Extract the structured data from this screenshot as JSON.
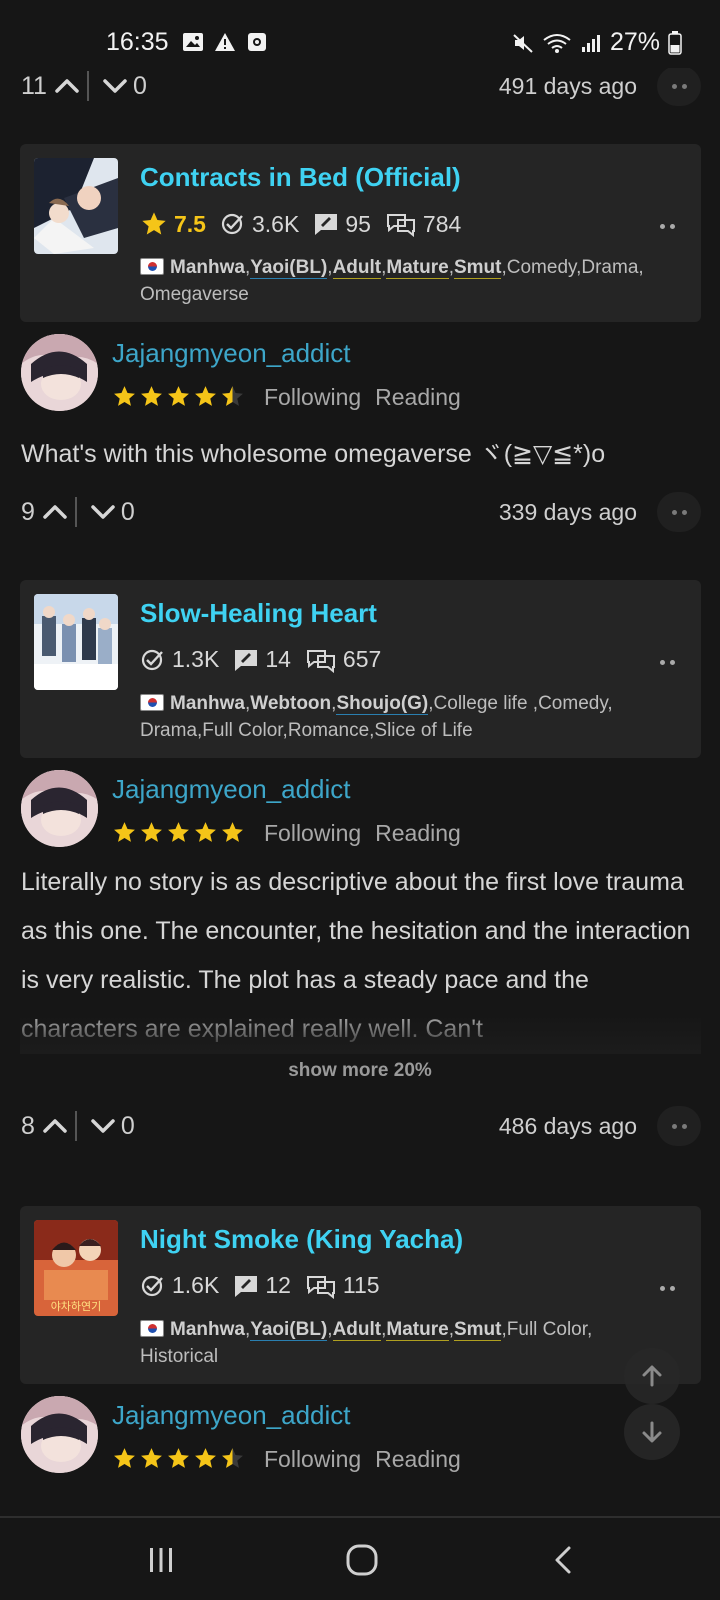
{
  "status_bar": {
    "time": "16:35",
    "battery": "27%",
    "left_icons": [
      "gallery-icon",
      "warning-icon",
      "app-icon"
    ],
    "right_icons": [
      "mute-icon",
      "wifi-icon",
      "signal-icon",
      "battery-icon"
    ]
  },
  "entries": [
    {
      "top_vote": {
        "up": "11",
        "down": "0",
        "ago": "491 days ago"
      }
    },
    {
      "card": {
        "title": "Contracts in Bed (Official)",
        "rating": "7.5",
        "follows": "3.6K",
        "reviews": "95",
        "comments": "784",
        "country": "Manhwa",
        "tags_bold": [
          "Yaoi(BL)",
          "Adult",
          "Mature",
          "Smut"
        ],
        "tags_rest": "Comedy,Drama,",
        "tags_line2": "Omegaverse"
      },
      "reviewer": {
        "name": "Jajangmyeon_addict",
        "stars": 4.5,
        "status1": "Following",
        "status2": "Reading"
      },
      "review": "What's with this wholesome omegaverse ヾ(≧▽≦*)o",
      "vote": {
        "up": "9",
        "down": "0",
        "ago": "339 days ago"
      }
    },
    {
      "card": {
        "title": "Slow-Healing Heart",
        "follows": "1.3K",
        "reviews": "14",
        "comments": "657",
        "country": "Manhwa",
        "tag1": "Webtoon",
        "tag2": "Shoujo(G)",
        "tags_rest": "College life ,Comedy,",
        "tags_line2": "Drama,Full Color,Romance,Slice of Life"
      },
      "reviewer": {
        "name": "Jajangmyeon_addict",
        "stars": 5,
        "status1": "Following",
        "status2": "Reading"
      },
      "review": "Literally no story is as descriptive about the first love trauma as this one. The encounter, the hesitation and the interaction is very realistic. The plot has a steady pace and the characters are explained really well. Can't",
      "show_more": "show more 20%",
      "vote": {
        "up": "8",
        "down": "0",
        "ago": "486 days ago"
      }
    },
    {
      "card": {
        "title": "Night Smoke (King Yacha)",
        "follows": "1.6K",
        "reviews": "12",
        "comments": "115",
        "country": "Manhwa",
        "tags_bold": [
          "Yaoi(BL)",
          "Adult",
          "Mature",
          "Smut"
        ],
        "tags_rest": "Full Color,",
        "tags_line2": "Historical",
        "cover_text": "야차하연기"
      },
      "reviewer": {
        "name": "Jajangmyeon_addict",
        "stars": 4.5,
        "status1": "Following",
        "status2": "Reading"
      }
    }
  ],
  "colors": {
    "accent_title": "#3fd2f2",
    "username": "#3da6c9",
    "star": "#f5c518",
    "background": "#161616",
    "card": "#252525"
  }
}
